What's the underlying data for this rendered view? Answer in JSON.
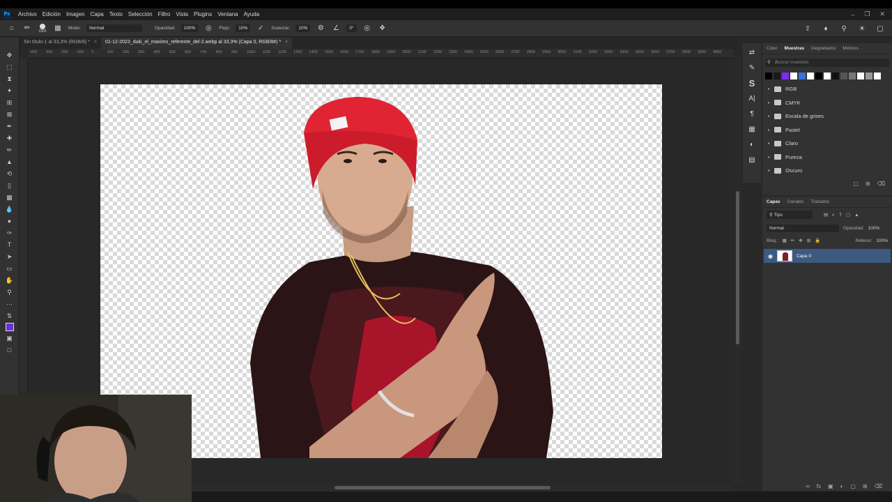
{
  "app": {
    "logo": "Ps"
  },
  "menu": [
    "Archivo",
    "Edición",
    "Imagen",
    "Capa",
    "Texto",
    "Selección",
    "Filtro",
    "Vista",
    "Plugins",
    "Ventana",
    "Ayuda"
  ],
  "options": {
    "brush_size": "1503",
    "mode_label": "Modo:",
    "mode_value": "Normal",
    "opacity_label": "Opacidad:",
    "opacity_value": "100%",
    "flow_label": "Flujo:",
    "flow_value": "10%",
    "smoothing_label": "Suavizar:",
    "smoothing_value": "10%",
    "angle_value": "0°"
  },
  "tabs": [
    {
      "label": "Sin título-1 al 33,3% (RGB/8) *"
    },
    {
      "label": "01-12-2023_duki_el_maximo_referente_del-2.webp al 33,3% (Capa 0, RGB/8#) *"
    }
  ],
  "ruler_ticks": [
    "-400",
    "-300",
    "-200",
    "-100",
    "0",
    "100",
    "200",
    "300",
    "400",
    "500",
    "600",
    "700",
    "800",
    "900",
    "1000",
    "1100",
    "1200",
    "1300",
    "1400",
    "1500",
    "1600",
    "1700",
    "1800",
    "1900",
    "2000",
    "2100",
    "2200",
    "2300",
    "2400",
    "2500",
    "2600",
    "2700",
    "2800",
    "2900",
    "3000",
    "3100",
    "3200",
    "3300",
    "3400",
    "3500",
    "3600",
    "3700",
    "3800",
    "3900",
    "4000"
  ],
  "swatches_panel": {
    "tabs": [
      "Color",
      "Muestras",
      "Degradados",
      "Motivos"
    ],
    "active_tab": "Muestras",
    "search_placeholder": "Buscar muestras",
    "swatch_colors": [
      "#000000",
      "#1a1a1a",
      "#7b2cf0",
      "#ffffff",
      "#3b6fd8",
      "#ffffff",
      "#000000",
      "#ffffff",
      "#111111",
      "#555555",
      "#777777",
      "#ffffff",
      "#999999",
      "#ffffff"
    ],
    "groups": [
      "RGB",
      "CMYK",
      "Escala de grises",
      "Pastel",
      "Claro",
      "Pureza",
      "Oscuro"
    ]
  },
  "layers_panel": {
    "tabs": [
      "Capas",
      "Canales",
      "Trazados"
    ],
    "active_tab": "Capas",
    "filter_kind": "Tipo",
    "blend_mode": "Normal",
    "opacity_label": "Opacidad:",
    "opacity_value": "100%",
    "lock_label": "Bloq.:",
    "fill_label": "Relleno:",
    "fill_value": "100%",
    "layers": [
      {
        "name": "Capa 0"
      }
    ]
  }
}
